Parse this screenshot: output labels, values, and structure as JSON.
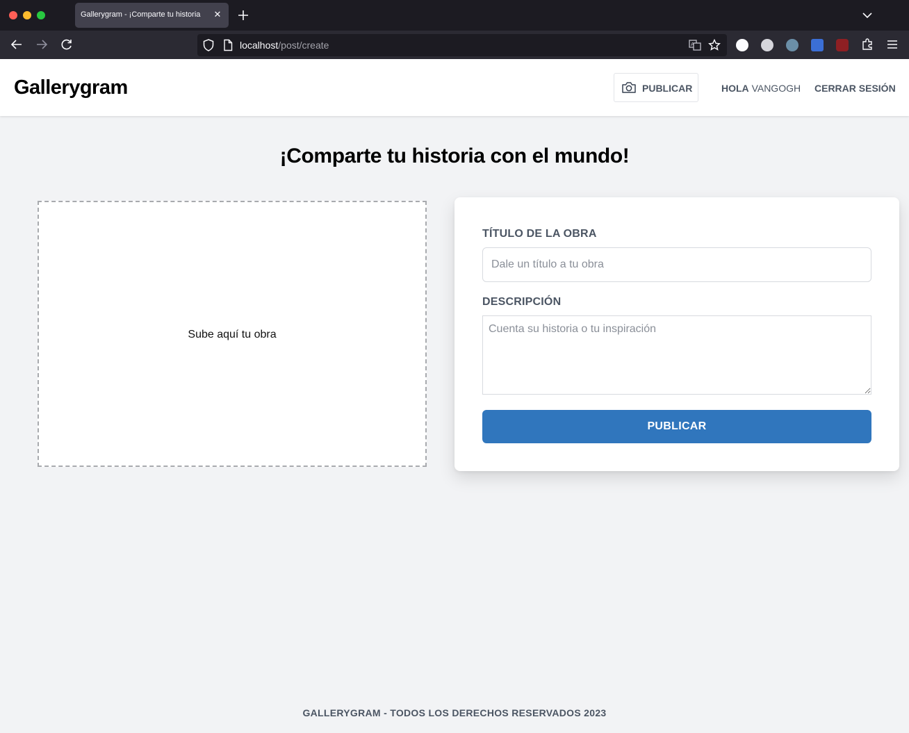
{
  "browser": {
    "tab_title": "Gallerygram - ¡Comparte tu historia",
    "tab_close": "✕",
    "url_host": "localhost",
    "url_path": "/post/create",
    "icons": {
      "back": "back-arrow-icon",
      "forward": "forward-arrow-icon",
      "reload": "reload-icon",
      "shield": "shield-icon",
      "page": "page-icon",
      "translate": "translate-icon",
      "bookmark": "star-icon",
      "extensions": "puzzle-icon",
      "menu": "hamburger-menu-icon"
    }
  },
  "header": {
    "brand": "Gallerygram",
    "publish_label": "PUBLICAR",
    "greeting_prefix": "HOLA",
    "username": "VANGOGH",
    "logout_label": "CERRAR SESIÓN"
  },
  "main": {
    "title": "¡Comparte tu historia con el mundo!",
    "dropzone_text": "Sube aquí tu obra",
    "form": {
      "title_label": "TÍTULO DE LA OBRA",
      "title_placeholder": "Dale un título a tu obra",
      "title_value": "",
      "description_label": "DESCRIPCIÓN",
      "description_placeholder": "Cuenta su historia o tu inspiración",
      "description_value": "",
      "submit_label": "PUBLICAR"
    }
  },
  "footer": {
    "text": "GALLERYGRAM - TODOS LOS DERECHOS RESERVADOS 2023"
  },
  "colors": {
    "accent": "#3076bd",
    "page_bg": "#f2f3f5",
    "muted_text": "#4b5563"
  }
}
